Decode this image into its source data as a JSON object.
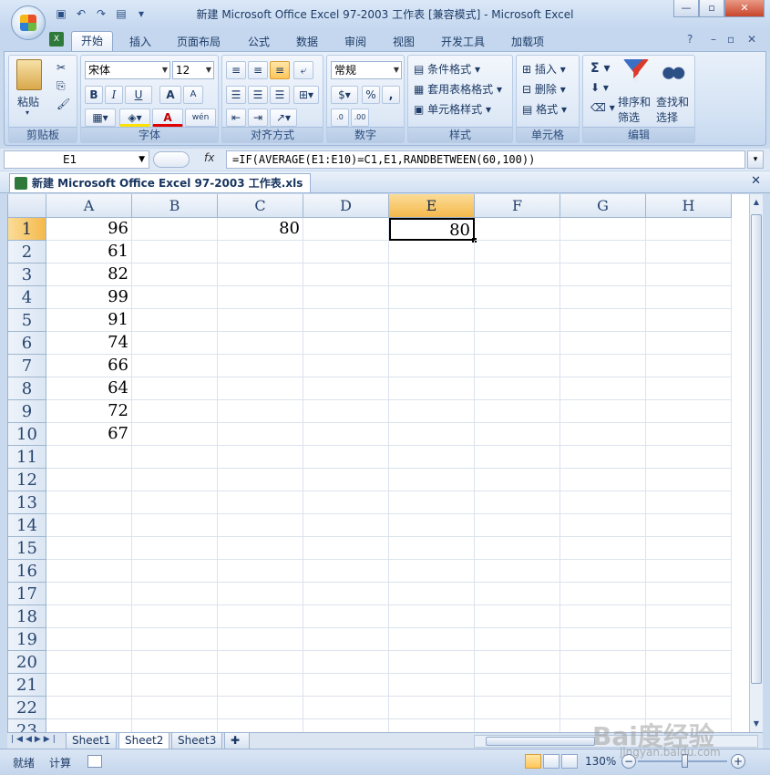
{
  "window": {
    "title": "新建 Microsoft Office Excel 97-2003 工作表 [兼容模式] - Microsoft Excel"
  },
  "ribbon_tabs": [
    "开始",
    "插入",
    "页面布局",
    "公式",
    "数据",
    "审阅",
    "视图",
    "开发工具",
    "加载项"
  ],
  "ribbon": {
    "clipboard": {
      "label": "剪贴板",
      "paste": "粘贴"
    },
    "font": {
      "label": "字体",
      "name": "宋体",
      "size": "12",
      "bold": "B",
      "italic": "I",
      "underline": "U",
      "grow": "A",
      "shrink": "A",
      "font_color": "A",
      "phonetic": "wén"
    },
    "alignment": {
      "label": "对齐方式"
    },
    "number": {
      "label": "数字",
      "format": "常规",
      "percent": "%",
      "comma": ","
    },
    "styles": {
      "label": "样式",
      "cond": "条件格式",
      "table": "套用表格格式",
      "cell": "单元格样式"
    },
    "cells": {
      "label": "单元格",
      "insert": "插入",
      "delete": "删除",
      "format": "格式"
    },
    "editing": {
      "label": "编辑",
      "sigma": "Σ",
      "sort1": "排序和",
      "sort2": "筛选",
      "find1": "查找和",
      "find2": "选择"
    }
  },
  "formula_bar": {
    "name_box": "E1",
    "fx": "fx",
    "formula": "=IF(AVERAGE(E1:E10)=C1,E1,RANDBETWEEN(60,100))"
  },
  "workbook_tab": "新建 Microsoft Office Excel 97-2003 工作表.xls",
  "columns": [
    "A",
    "B",
    "C",
    "D",
    "E",
    "F",
    "G",
    "H"
  ],
  "selected_column": "E",
  "rows": [
    "1",
    "2",
    "3",
    "4",
    "5",
    "6",
    "7",
    "8",
    "9",
    "10",
    "11",
    "12",
    "13",
    "14",
    "15",
    "16",
    "17",
    "18",
    "19",
    "20",
    "21",
    "22",
    "23"
  ],
  "selected_row": "1",
  "cells": {
    "A": [
      "96",
      "61",
      "82",
      "99",
      "91",
      "74",
      "66",
      "64",
      "72",
      "67"
    ],
    "C1": "80",
    "E1": "80"
  },
  "sheets": [
    "Sheet1",
    "Sheet2",
    "Sheet3"
  ],
  "active_sheet": "Sheet2",
  "status": {
    "ready": "就绪",
    "calc": "计算",
    "zoom": "130%",
    "zoom_minus": "−",
    "zoom_plus": "+"
  },
  "watermark": {
    "brand": "Bai度经验",
    "url": "jingyan.baidu.com"
  },
  "colors": {
    "selected_header": "#f4b94d",
    "ribbon": "#d3e2f4"
  }
}
